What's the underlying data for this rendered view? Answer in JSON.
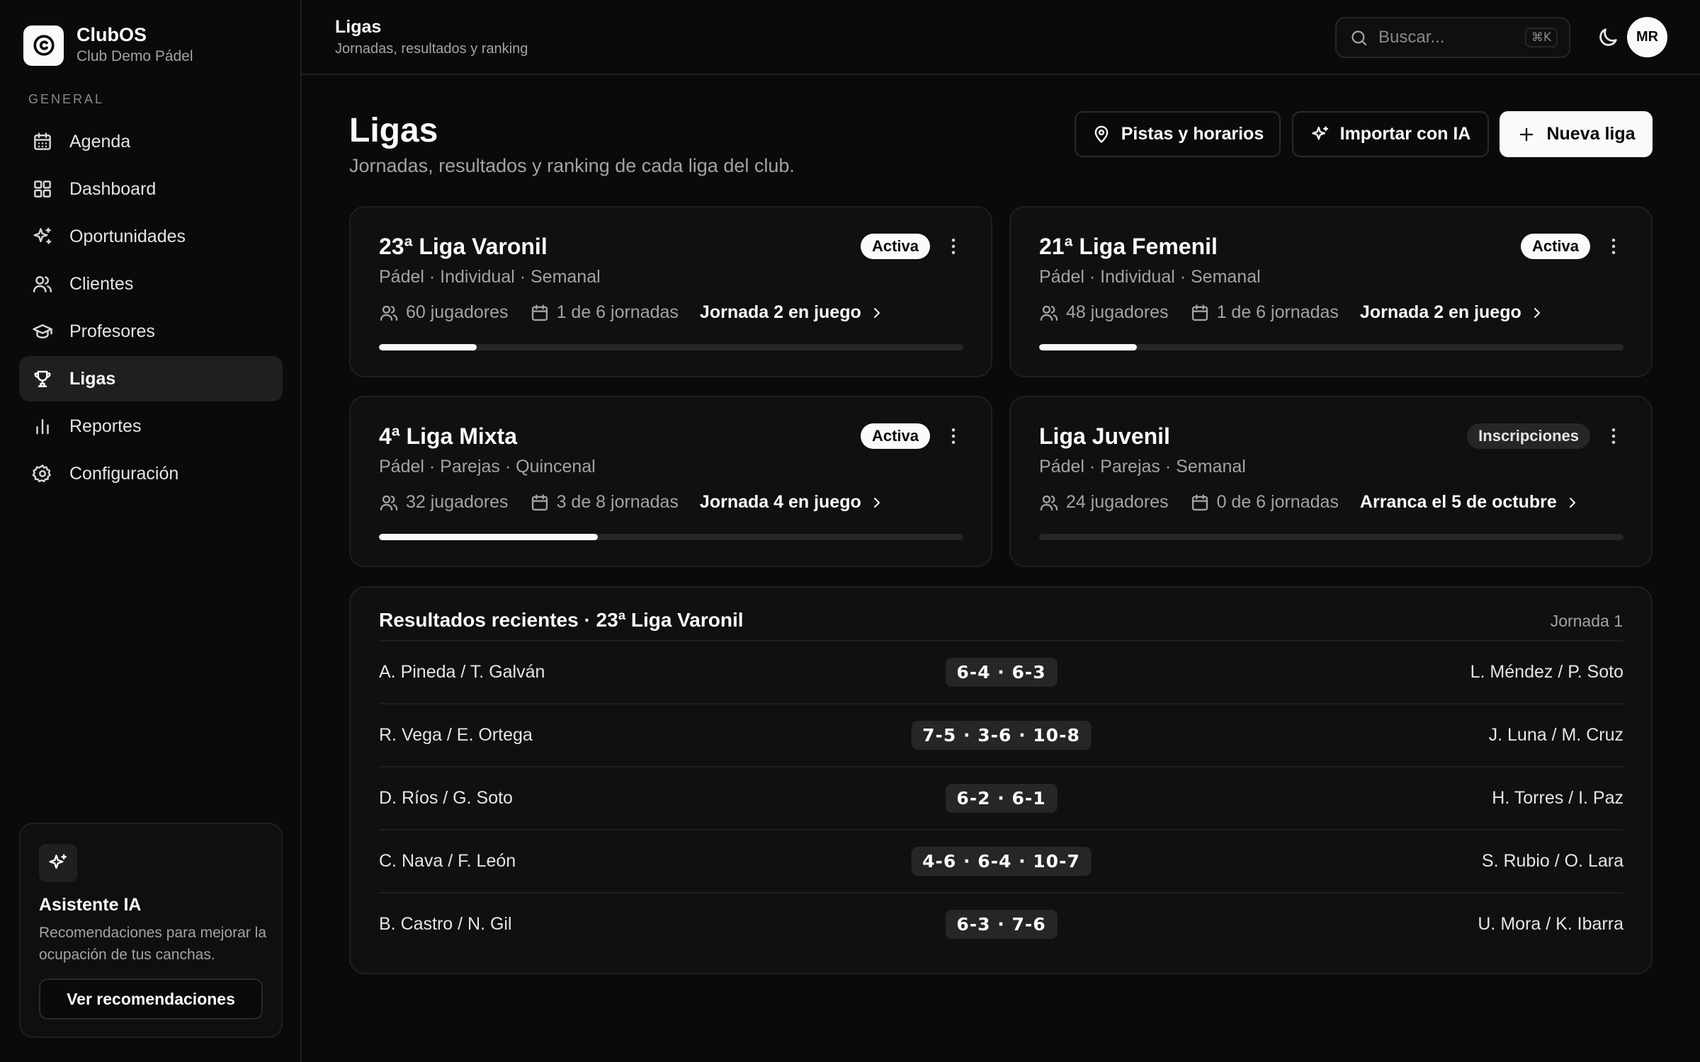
{
  "brand": {
    "name": "ClubOS",
    "subtitle": "Club Demo Pádel",
    "logo_icon": "logo-icon"
  },
  "sidebar": {
    "section_label": "General",
    "items": [
      {
        "label": "Agenda",
        "icon": "calendar-icon",
        "active": false
      },
      {
        "label": "Dashboard",
        "icon": "grid-icon",
        "active": false
      },
      {
        "label": "Oportunidades",
        "icon": "sparkles-icon",
        "active": false
      },
      {
        "label": "Clientes",
        "icon": "users-icon",
        "active": false
      },
      {
        "label": "Profesores",
        "icon": "graduation-cap-icon",
        "active": false
      },
      {
        "label": "Ligas",
        "icon": "trophy-icon",
        "active": true
      },
      {
        "label": "Reportes",
        "icon": "bar-chart-icon",
        "active": false
      },
      {
        "label": "Configuración",
        "icon": "gear-icon",
        "active": false
      }
    ],
    "ai_card": {
      "title": "Asistente IA",
      "description": "Recomendaciones para mejorar la ocupación de tus canchas.",
      "button": "Ver recomendaciones"
    }
  },
  "topbar": {
    "title": "Ligas",
    "subtitle": "Jornadas, resultados y ranking",
    "search_placeholder": "Buscar...",
    "search_shortcut": "⌘K",
    "avatar_initials": "MR"
  },
  "page": {
    "title": "Ligas",
    "subtitle": "Jornadas, resultados y ranking de cada liga del club.",
    "actions": {
      "courts": "Pistas y horarios",
      "import": "Importar con IA",
      "new": "Nueva liga"
    }
  },
  "leagues": [
    {
      "name": "23ª Liga Varonil",
      "meta": "Pádel · Individual · Semanal",
      "status": "Activa",
      "players": "60 jugadores",
      "rounds": "1 de 6 jornadas",
      "link": "Jornada 2 en juego",
      "progress": 0.167
    },
    {
      "name": "21ª Liga Femenil",
      "meta": "Pádel · Individual · Semanal",
      "status": "Activa",
      "players": "48 jugadores",
      "rounds": "1 de 6 jornadas",
      "link": "Jornada 2 en juego",
      "progress": 0.167
    },
    {
      "name": "4ª Liga Mixta",
      "meta": "Pádel · Parejas · Quincenal",
      "status": "Activa",
      "players": "32 jugadores",
      "rounds": "3 de 8 jornadas",
      "link": "Jornada 4 en juego",
      "progress": 0.375
    },
    {
      "name": "Liga Juvenil",
      "meta": "Pádel · Parejas · Semanal",
      "status": "Inscripciones",
      "players": "24 jugadores",
      "rounds": "0 de 6 jornadas",
      "link": "Arranca el 5 de octubre",
      "progress": 0
    }
  ],
  "results": {
    "title": "Resultados recientes · 23ª Liga Varonil",
    "round": "Jornada 1",
    "rows": [
      {
        "home": "A. Pineda / T. Galván",
        "score": "6-4 · 6-3",
        "away": "L. Méndez / P. Soto"
      },
      {
        "home": "R. Vega / E. Ortega",
        "score": "7-5 · 3-6 · 10-8",
        "away": "J. Luna / M. Cruz"
      },
      {
        "home": "D. Ríos / G. Soto",
        "score": "6-2 · 6-1",
        "away": "H. Torres / I. Paz"
      },
      {
        "home": "C. Nava / F. León",
        "score": "4-6 · 6-4 · 10-7",
        "away": "S. Rubio / O. Lara"
      },
      {
        "home": "B. Castro / N. Gil",
        "score": "6-3 · 7-6",
        "away": "U. Mora / K. Ibarra"
      }
    ]
  },
  "colors": {
    "background": "#0a0a0a",
    "card": "#101010",
    "border": "#1f1f1f",
    "accent": "#fafafa",
    "muted_text": "#a3a3a3"
  }
}
